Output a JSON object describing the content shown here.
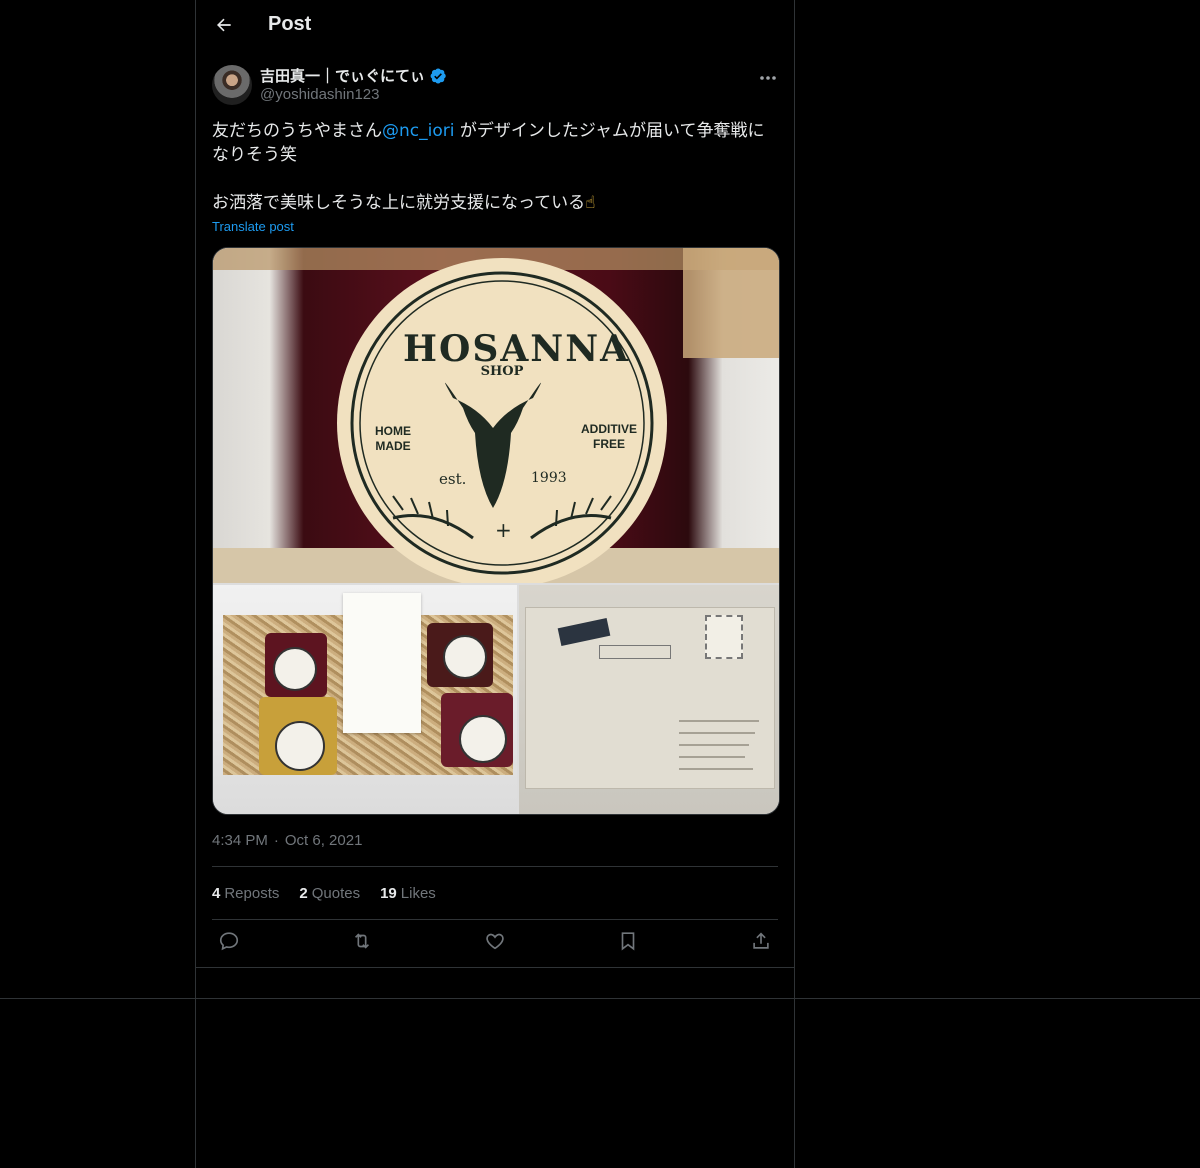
{
  "header": {
    "title": "Post",
    "back_icon": "arrow-left-icon"
  },
  "author": {
    "display_name": "吉田真一｜でぃぐにてぃ",
    "handle": "@yoshidashin123",
    "verified_icon": "verified-badge-icon",
    "verified_color": "#1d9bf0"
  },
  "post": {
    "text_part1": "友だちのうちやまさん",
    "mention": "@nc_iori",
    "text_part2": " がデザインしたジャムが届いて争奪戦になりそう笑",
    "text_line2": "お洒落で美味しそうな上に就労支援になっている",
    "emoji": "☝",
    "translate_label": "Translate post",
    "media_logo": {
      "name": "HOSANNA",
      "shop": "SHOP",
      "left": "HOME MADE",
      "right": "ADDITIVE FREE",
      "est": "est.",
      "year": "1993"
    }
  },
  "meta": {
    "time": "4:34 PM",
    "separator": "·",
    "date": "Oct 6, 2021"
  },
  "stats": {
    "reposts_count": "4",
    "reposts_label": "Reposts",
    "quotes_count": "2",
    "quotes_label": "Quotes",
    "likes_count": "19",
    "likes_label": "Likes"
  },
  "actions": [
    "reply-icon",
    "repost-icon",
    "like-icon",
    "bookmark-icon",
    "share-icon"
  ],
  "colors": {
    "background": "#000000",
    "text": "#e7e9ea",
    "secondary": "#71767b",
    "accent": "#1d9bf0",
    "border": "#2f3336"
  }
}
